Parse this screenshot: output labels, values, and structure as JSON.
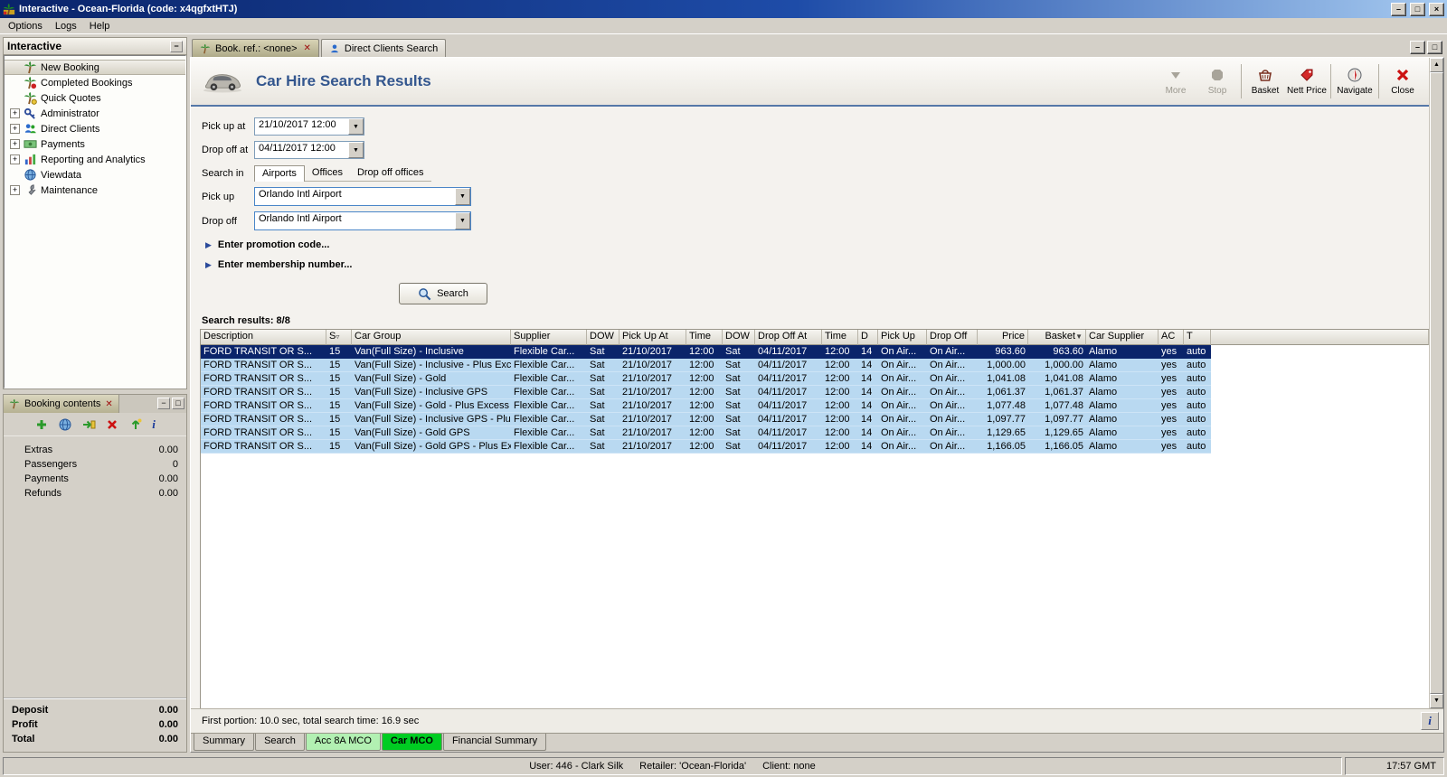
{
  "window": {
    "title": "Interactive - Ocean-Florida (code: x4qgfxtHTJ)",
    "menu": {
      "options": "Options",
      "logs": "Logs",
      "help": "Help"
    }
  },
  "icons": {
    "minimize": "–",
    "maximize": "□",
    "close": "×",
    "dropdown": "▼",
    "up_arrow": "▲",
    "down_arrow": "▼",
    "expand": "+",
    "collapse": "−",
    "bullet": "▶",
    "sort": "▼",
    "filter": "▿",
    "info": "i",
    "close_tab": "✕"
  },
  "sidebar": {
    "title": "Interactive",
    "items": [
      {
        "label": "New Booking",
        "selected": true
      },
      {
        "label": "Completed Bookings"
      },
      {
        "label": "Quick Quotes"
      },
      {
        "label": "Administrator",
        "expandable": true
      },
      {
        "label": "Direct Clients",
        "expandable": true
      },
      {
        "label": "Payments",
        "expandable": true
      },
      {
        "label": "Reporting and Analytics",
        "expandable": true
      },
      {
        "label": "Viewdata"
      },
      {
        "label": "Maintenance",
        "expandable": true
      }
    ]
  },
  "booking_contents": {
    "title": "Booking contents",
    "rows": [
      {
        "label": "Extras",
        "value": "0.00"
      },
      {
        "label": "Passengers",
        "value": "0"
      },
      {
        "label": "Payments",
        "value": "0.00"
      },
      {
        "label": "Refunds",
        "value": "0.00"
      }
    ],
    "totals": [
      {
        "label": "Deposit",
        "value": "0.00"
      },
      {
        "label": "Profit",
        "value": "0.00"
      },
      {
        "label": "Total",
        "value": "0.00"
      }
    ]
  },
  "doc_tabs": [
    {
      "label": "Book. ref.: <none>"
    },
    {
      "label": "Direct Clients Search"
    }
  ],
  "page": {
    "title": "Car Hire Search Results",
    "toolbar": {
      "more": "More",
      "stop": "Stop",
      "basket": "Basket",
      "nett_price": "Nett Price",
      "navigate": "Navigate",
      "close": "Close"
    },
    "form": {
      "pick_up_at_label": "Pick up at",
      "pick_up_at_value": "21/10/2017 12:00",
      "drop_off_at_label": "Drop off at",
      "drop_off_at_value": "04/11/2017 12:00",
      "search_in_label": "Search in",
      "search_in_tabs": [
        "Airports",
        "Offices",
        "Drop off offices"
      ],
      "pick_up_label": "Pick up",
      "pick_up_value": "Orlando Intl Airport",
      "drop_off_label": "Drop off",
      "drop_off_value": "Orlando Intl Airport",
      "promotion_label": "Enter promotion code...",
      "membership_label": "Enter membership number...",
      "search_button": "Search"
    },
    "results": {
      "summary": "Search results: 8/8",
      "columns": [
        "Description",
        "S",
        "Car Group",
        "Supplier",
        "DOW",
        "Pick Up At",
        "Time",
        "DOW",
        "Drop Off At",
        "Time",
        "D",
        "Pick Up",
        "Drop Off",
        "Price",
        "Basket",
        "Car Supplier",
        "AC",
        "T"
      ],
      "rows": [
        {
          "selected": true,
          "desc": "FORD TRANSIT OR S...",
          "s": "15",
          "group": "Van(Full Size) - Inclusive",
          "supplier": "Flexible Car...",
          "dow1": "Sat",
          "pick_date": "21/10/2017",
          "time1": "12:00",
          "dow2": "Sat",
          "drop_date": "04/11/2017",
          "time2": "12:00",
          "d": "14",
          "pick_loc": "On Air...",
          "drop_loc": "On Air...",
          "price": "963.60",
          "basket": "963.60",
          "car_supplier": "Alamo",
          "ac": "yes",
          "t": "auto"
        },
        {
          "desc": "FORD TRANSIT OR S...",
          "s": "15",
          "group": "Van(Full Size) - Inclusive - Plus Excess...",
          "supplier": "Flexible Car...",
          "dow1": "Sat",
          "pick_date": "21/10/2017",
          "time1": "12:00",
          "dow2": "Sat",
          "drop_date": "04/11/2017",
          "time2": "12:00",
          "d": "14",
          "pick_loc": "On Air...",
          "drop_loc": "On Air...",
          "price": "1,000.00",
          "basket": "1,000.00",
          "car_supplier": "Alamo",
          "ac": "yes",
          "t": "auto"
        },
        {
          "desc": "FORD TRANSIT OR S...",
          "s": "15",
          "group": "Van(Full Size) - Gold",
          "supplier": "Flexible Car...",
          "dow1": "Sat",
          "pick_date": "21/10/2017",
          "time1": "12:00",
          "dow2": "Sat",
          "drop_date": "04/11/2017",
          "time2": "12:00",
          "d": "14",
          "pick_loc": "On Air...",
          "drop_loc": "On Air...",
          "price": "1,041.08",
          "basket": "1,041.08",
          "car_supplier": "Alamo",
          "ac": "yes",
          "t": "auto"
        },
        {
          "desc": "FORD TRANSIT OR S...",
          "s": "15",
          "group": "Van(Full Size) - Inclusive GPS",
          "supplier": "Flexible Car...",
          "dow1": "Sat",
          "pick_date": "21/10/2017",
          "time1": "12:00",
          "dow2": "Sat",
          "drop_date": "04/11/2017",
          "time2": "12:00",
          "d": "14",
          "pick_loc": "On Air...",
          "drop_loc": "On Air...",
          "price": "1,061.37",
          "basket": "1,061.37",
          "car_supplier": "Alamo",
          "ac": "yes",
          "t": "auto"
        },
        {
          "desc": "FORD TRANSIT OR S...",
          "s": "15",
          "group": "Van(Full Size) - Gold - Plus Excess Ref...",
          "supplier": "Flexible Car...",
          "dow1": "Sat",
          "pick_date": "21/10/2017",
          "time1": "12:00",
          "dow2": "Sat",
          "drop_date": "04/11/2017",
          "time2": "12:00",
          "d": "14",
          "pick_loc": "On Air...",
          "drop_loc": "On Air...",
          "price": "1,077.48",
          "basket": "1,077.48",
          "car_supplier": "Alamo",
          "ac": "yes",
          "t": "auto"
        },
        {
          "desc": "FORD TRANSIT OR S...",
          "s": "15",
          "group": "Van(Full Size) - Inclusive GPS - Plus Ex...",
          "supplier": "Flexible Car...",
          "dow1": "Sat",
          "pick_date": "21/10/2017",
          "time1": "12:00",
          "dow2": "Sat",
          "drop_date": "04/11/2017",
          "time2": "12:00",
          "d": "14",
          "pick_loc": "On Air...",
          "drop_loc": "On Air...",
          "price": "1,097.77",
          "basket": "1,097.77",
          "car_supplier": "Alamo",
          "ac": "yes",
          "t": "auto"
        },
        {
          "desc": "FORD TRANSIT OR S...",
          "s": "15",
          "group": "Van(Full Size) - Gold GPS",
          "supplier": "Flexible Car...",
          "dow1": "Sat",
          "pick_date": "21/10/2017",
          "time1": "12:00",
          "dow2": "Sat",
          "drop_date": "04/11/2017",
          "time2": "12:00",
          "d": "14",
          "pick_loc": "On Air...",
          "drop_loc": "On Air...",
          "price": "1,129.65",
          "basket": "1,129.65",
          "car_supplier": "Alamo",
          "ac": "yes",
          "t": "auto"
        },
        {
          "desc": "FORD TRANSIT OR S...",
          "s": "15",
          "group": "Van(Full Size) - Gold GPS - Plus Excess...",
          "supplier": "Flexible Car...",
          "dow1": "Sat",
          "pick_date": "21/10/2017",
          "time1": "12:00",
          "dow2": "Sat",
          "drop_date": "04/11/2017",
          "time2": "12:00",
          "d": "14",
          "pick_loc": "On Air...",
          "drop_loc": "On Air...",
          "price": "1,166.05",
          "basket": "1,166.05",
          "car_supplier": "Alamo",
          "ac": "yes",
          "t": "auto"
        }
      ]
    },
    "status_line": "First portion: 10.0 sec, total search time: 16.9 sec",
    "bottom_tabs": [
      "Summary",
      "Search",
      "Acc 8A MCO",
      "Car MCO",
      "Financial Summary"
    ]
  },
  "statusbar": {
    "user": "User: 446 - Clark Silk",
    "retailer": "Retailer: 'Ocean-Florida'",
    "client": "Client: none",
    "time": "17:57 GMT"
  }
}
